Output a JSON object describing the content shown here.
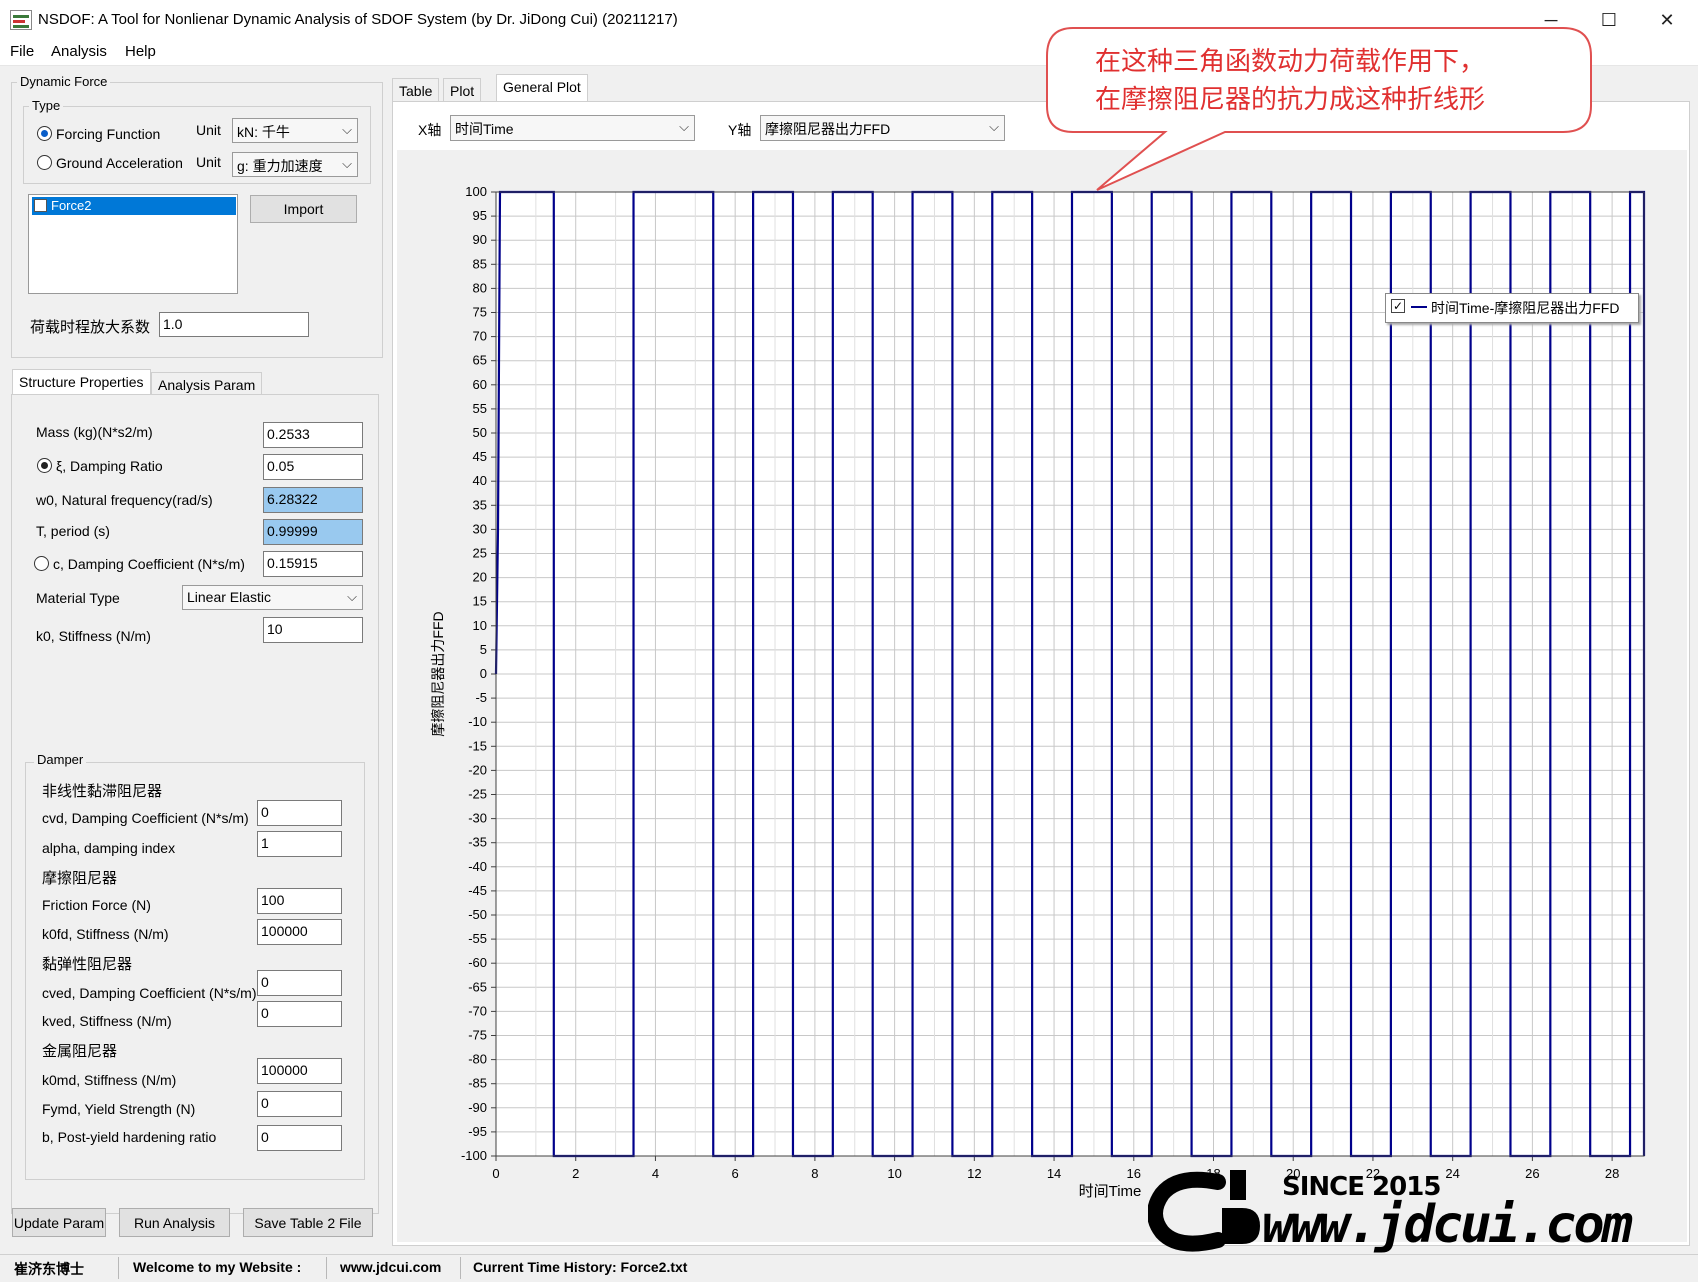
{
  "window": {
    "title": "NSDOF: A Tool for Nonlienar Dynamic Analysis of SDOF System (by Dr. JiDong Cui) (20211217)",
    "minimize": "─",
    "maximize": "☐",
    "close": "✕"
  },
  "menu": [
    "File",
    "Analysis",
    "Help"
  ],
  "dynamic_force": {
    "group_label": "Dynamic Force",
    "type_label": "Type",
    "forcing_function": "Forcing Function",
    "ground_acceleration": "Ground Acceleration",
    "unit_label": "Unit",
    "unit_force": "kN: 千牛",
    "unit_accel": "g: 重力加速度",
    "list_item": "Force2",
    "import_button": "Import",
    "scale_label": "荷载时程放大系数",
    "scale_value": "1.0"
  },
  "left_tabs": [
    "Structure Properties",
    "Analysis Param"
  ],
  "structure": {
    "mass_label": "Mass (kg)(N*s2/m)",
    "mass_value": "0.2533",
    "damping_ratio_label": "ξ, Damping Ratio",
    "damping_ratio_value": "0.05",
    "w0_label": "w0, Natural frequency(rad/s)",
    "w0_value": "6.28322",
    "period_label": "T, period (s)",
    "period_value": "0.99999",
    "c_label": "c, Damping Coefficient (N*s/m)",
    "c_value": "0.15915",
    "material_label": "Material Type",
    "material_value": "Linear Elastic",
    "k0_label": "k0, Stiffness (N/m)",
    "k0_value": "10"
  },
  "damper": {
    "group_label": "Damper",
    "viscous_title": "非线性黏滞阻尼器",
    "cvd_label": "cvd, Damping Coefficient (N*s/m)",
    "cvd_value": "0",
    "alpha_label": "alpha, damping index",
    "alpha_value": "1",
    "friction_title": "摩擦阻尼器",
    "friction_label": "Friction Force (N)",
    "friction_value": "100",
    "k0fd_label": "k0fd, Stiffness (N/m)",
    "k0fd_value": "100000",
    "viscoelastic_title": "黏弹性阻尼器",
    "cved_label": "cved, Damping Coefficient (N*s/m)",
    "cved_value": "0",
    "kved_label": "kved, Stiffness (N/m)",
    "kved_value": "0",
    "metal_title": "金属阻尼器",
    "k0md_label": "k0md, Stiffness (N/m)",
    "k0md_value": "100000",
    "fymd_label": "Fymd, Yield Strength (N)",
    "fymd_value": "0",
    "b_label": "b, Post-yield hardening ratio",
    "b_value": "0"
  },
  "buttons": {
    "update": "Update Param",
    "run": "Run Analysis",
    "save": "Save Table 2 File"
  },
  "right_tabs": [
    "Table",
    "Plot",
    "General Plot"
  ],
  "axes_select": {
    "x_label": "X轴",
    "x_value": "时间Time",
    "y_label": "Y轴",
    "y_value": "摩擦阻尼器出力FFD"
  },
  "callout": {
    "line1": "在这种三角函数动力荷载作用下，",
    "line2": "在摩擦阻尼器的抗力成这种折线形"
  },
  "chart_data": {
    "type": "line",
    "xlabel": "时间Time",
    "ylabel": "摩擦阻尼器出力FFD",
    "xlim": [
      0,
      28.8
    ],
    "ylim": [
      -100,
      100
    ],
    "x_ticks": [
      0,
      2,
      4,
      6,
      8,
      10,
      12,
      14,
      16,
      18,
      20,
      22,
      24,
      26,
      28
    ],
    "y_ticks": [
      100,
      95,
      90,
      85,
      80,
      75,
      70,
      65,
      60,
      55,
      50,
      45,
      40,
      35,
      30,
      25,
      20,
      15,
      10,
      5,
      0,
      -5,
      -10,
      -15,
      -20,
      -25,
      -30,
      -35,
      -40,
      -45,
      -50,
      -55,
      -60,
      -65,
      -70,
      -75,
      -80,
      -85,
      -90,
      -95,
      -100
    ],
    "grid": true,
    "legend": {
      "placement": "top-right",
      "checked": true
    },
    "series": [
      {
        "name": "时间Time-摩擦阻尼器出力FFD",
        "color": "#00008b",
        "x": [
          0,
          0.05,
          0.1,
          0.7,
          1.45,
          2.95,
          3.45,
          4.45,
          5.45,
          6.45,
          7.45,
          8.45,
          9.45,
          10.45,
          11.45,
          12.45,
          13.45,
          14.45,
          15.45,
          16.45,
          17.45,
          18.45,
          19.45,
          20.45,
          21.45,
          22.45,
          23.45,
          24.45,
          25.45,
          26.45,
          27.45,
          28.45,
          28.8
        ],
        "y": [
          0,
          30,
          100,
          100,
          -100,
          -100,
          100,
          100,
          -100,
          100,
          -100,
          100,
          -100,
          100,
          -100,
          100,
          -100,
          100,
          -100,
          100,
          -100,
          100,
          -100,
          100,
          -100,
          100,
          -100,
          100,
          -100,
          100,
          -100,
          100,
          -100
        ]
      }
    ]
  },
  "watermark": {
    "since": "SINCE 2015",
    "url": "www.jdcui.com",
    "logo": "CJD"
  },
  "statusbar": {
    "author": "崔济东博士",
    "welcome": "Welcome to my Website :",
    "site": "www.jdcui.com",
    "current": "Current Time History: Force2.txt"
  }
}
